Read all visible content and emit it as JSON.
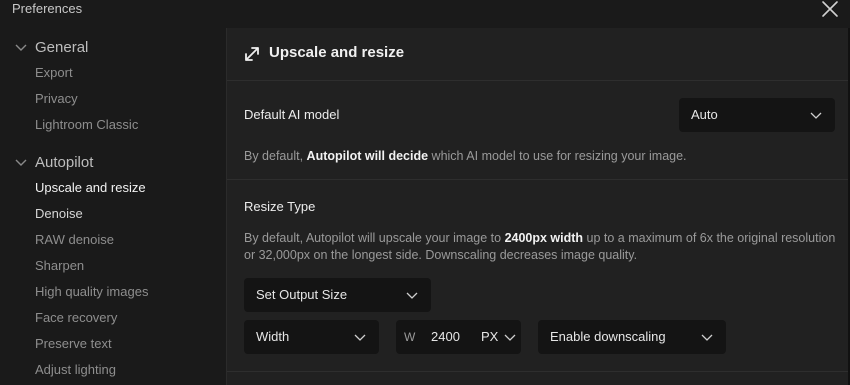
{
  "window": {
    "title": "Preferences"
  },
  "sidebar": {
    "sections": [
      {
        "label": "General",
        "items": [
          "Export",
          "Privacy",
          "Lightroom Classic"
        ]
      },
      {
        "label": "Autopilot",
        "items": [
          "Upscale and resize",
          "Denoise",
          "RAW denoise",
          "Sharpen",
          "High quality images",
          "Face recovery",
          "Preserve text",
          "Adjust lighting"
        ]
      }
    ],
    "active_item": "Upscale and resize"
  },
  "main": {
    "title": "Upscale and resize",
    "ai_model": {
      "label": "Default AI model",
      "value": "Auto",
      "desc_pre": "By default, ",
      "desc_bold": "Autopilot will decide",
      "desc_post": " which AI model to use for resizing your image."
    },
    "resize": {
      "label": "Resize Type",
      "desc_pre": "By default, Autopilot will upscale your image to ",
      "desc_bold": "2400px width",
      "desc_post": " up to a maximum of 6x the original resolution or 32,000px on the longest side. Downscaling decreases image quality.",
      "output_size": "Set Output Size",
      "dimension": "Width",
      "value_prefix": "W",
      "value": "2400",
      "unit": "PX",
      "downscaling": "Enable downscaling"
    }
  }
}
